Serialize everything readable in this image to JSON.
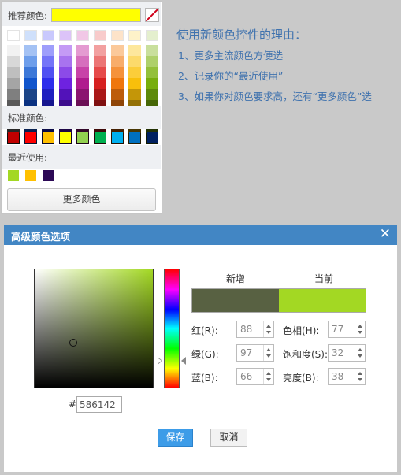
{
  "palette": {
    "recommended_label": "推荐颜色:",
    "recommended_color": "#ffff00",
    "standard_label": "标准颜色:",
    "recent_label": "最近使用:",
    "more_colors_label": "更多颜色",
    "theme_columns": [
      [
        "#ffffff",
        "#f2f2f2",
        "#d8d8d8",
        "#bfbfbf",
        "#a5a5a5",
        "#7f7f7f",
        "#595959",
        "#3f3f3f",
        "#262626",
        "#0c0c0c"
      ],
      [
        "#cfe0fb",
        "#a4c2f4",
        "#6d9eeb",
        "#3c78d8",
        "#1155cc",
        "#1c4587",
        "#0b3281",
        "#0a2b66",
        "#082152",
        "#061637"
      ],
      [
        "#c9c9fd",
        "#9e9efb",
        "#7474f8",
        "#5050f2",
        "#2d2deb",
        "#1f1fc0",
        "#17178f",
        "#101068",
        "#0b0b47",
        "#060628"
      ],
      [
        "#dcc3f8",
        "#c49af5",
        "#a873ef",
        "#8c4ae8",
        "#6e22e0",
        "#5212b9",
        "#3d0d8c",
        "#2c0965",
        "#1e0646",
        "#100326"
      ],
      [
        "#f1c7e6",
        "#e49bd1",
        "#d66fbd",
        "#c843a8",
        "#b01c8e",
        "#8b1570",
        "#6a1055",
        "#4c0b3d",
        "#33072a",
        "#1c0417"
      ],
      [
        "#f8cbcb",
        "#f2a0a0",
        "#ec7575",
        "#e64a4a",
        "#d62020",
        "#aa1818",
        "#801212",
        "#5c0d0d",
        "#3f0909",
        "#230505"
      ],
      [
        "#fde3c9",
        "#fbc99a",
        "#f8ad6a",
        "#f5923b",
        "#ef760d",
        "#bd5c0a",
        "#8e4507",
        "#663205",
        "#452103",
        "#251202"
      ],
      [
        "#fef2c9",
        "#fde79c",
        "#fcda6b",
        "#fbcd3a",
        "#f8bf0b",
        "#c49608",
        "#937006",
        "#6a5104",
        "#483703",
        "#271e02"
      ],
      [
        "#e4efce",
        "#c9df9d",
        "#aed06b",
        "#93c03a",
        "#77ae0c",
        "#5e8a09",
        "#466707",
        "#334b05",
        "#223203",
        "#121b02"
      ]
    ],
    "standard_colors": [
      "#c00000",
      "#ff0000",
      "#ffc000",
      "#ffff00",
      "#92d050",
      "#00b050",
      "#00b0f0",
      "#0070c0",
      "#002060"
    ],
    "recent_colors": [
      "#a3d823",
      "#ffc000",
      "#2c0955"
    ]
  },
  "reasons": {
    "title": "使用新颜色控件的理由：",
    "items": [
      "1、更多主流颜色方便选",
      "2、记录你的“最近使用”",
      "3、如果你对颜色要求高，还有“更多颜色”选"
    ]
  },
  "dialog": {
    "title": "高级颜色选项",
    "close_glyph": "✕",
    "new_label": "新增",
    "current_label": "当前",
    "new_color": "#586142",
    "current_color": "#a3d823",
    "hex_prefix": "#",
    "hex_value": "586142",
    "fields": {
      "red": {
        "label": "红(R):",
        "value": "88"
      },
      "green": {
        "label": "绿(G):",
        "value": "97"
      },
      "blue": {
        "label": "蓝(B):",
        "value": "66"
      },
      "hue": {
        "label": "色相(H):",
        "value": "77"
      },
      "sat": {
        "label": "饱和度(S):",
        "value": "32"
      },
      "bri": {
        "label": "亮度(B):",
        "value": "38"
      }
    },
    "save_label": "保存",
    "cancel_label": "取消"
  }
}
